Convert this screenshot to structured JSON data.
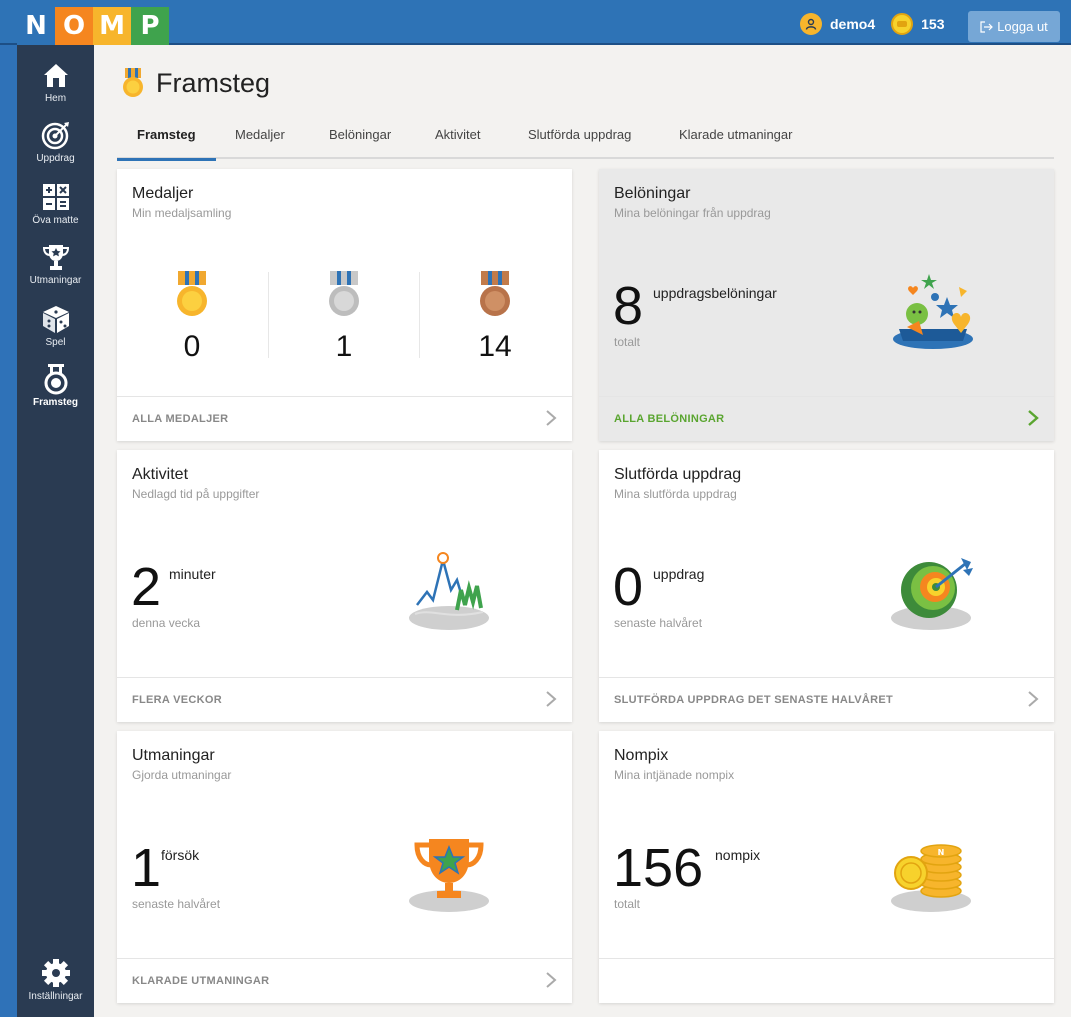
{
  "app": {
    "logo_letters": [
      "N",
      "O",
      "M",
      "P"
    ],
    "username": "demo4",
    "coins": "153",
    "logout_label": "Logga ut"
  },
  "sidebar": {
    "items": [
      {
        "label": "Hem",
        "icon": "home-icon"
      },
      {
        "label": "Uppdrag",
        "icon": "target-icon"
      },
      {
        "label": "Öva matte",
        "icon": "calculator-icon"
      },
      {
        "label": "Utmaningar",
        "icon": "trophy-icon"
      },
      {
        "label": "Spel",
        "icon": "dice-icon"
      },
      {
        "label": "Framsteg",
        "icon": "medal-icon",
        "active": true
      }
    ],
    "settings_label": "Inställningar"
  },
  "page": {
    "title": "Framsteg"
  },
  "tabs": [
    "Framsteg",
    "Medaljer",
    "Belöningar",
    "Aktivitet",
    "Slutförda uppdrag",
    "Klarade utmaningar"
  ],
  "cards": {
    "medaljer": {
      "title": "Medaljer",
      "subtitle": "Min medaljsamling",
      "gold": "0",
      "silver": "1",
      "bronze": "14",
      "footer": "ALLA MEDALJER"
    },
    "beloningar": {
      "title": "Belöningar",
      "subtitle": "Mina belöningar från uppdrag",
      "value": "8",
      "unit": "uppdragsbelöningar",
      "caption": "totalt",
      "footer": "ALLA BELÖNINGAR"
    },
    "aktivitet": {
      "title": "Aktivitet",
      "subtitle": "Nedlagd tid på uppgifter",
      "value": "2",
      "unit": "minuter",
      "caption": "denna vecka",
      "footer": "FLERA VECKOR"
    },
    "slutforda": {
      "title": "Slutförda uppdrag",
      "subtitle": "Mina slutförda uppdrag",
      "value": "0",
      "unit": "uppdrag",
      "caption": "senaste halvåret",
      "footer": "SLUTFÖRDA UPPDRAG DET SENASTE HALVÅRET"
    },
    "utmaningar": {
      "title": "Utmaningar",
      "subtitle": "Gjorda utmaningar",
      "value": "1",
      "unit": "försök",
      "caption": "senaste halvåret",
      "footer": "KLARADE UTMANINGAR"
    },
    "nompix": {
      "title": "Nompix",
      "subtitle": "Mina intjänade nompix",
      "value": "156",
      "unit": "nompix",
      "caption": "totalt"
    }
  },
  "colors": {
    "brand_blue": "#2e73b6",
    "sidebar": "#2a3b52",
    "accent_green": "#5aa530"
  }
}
